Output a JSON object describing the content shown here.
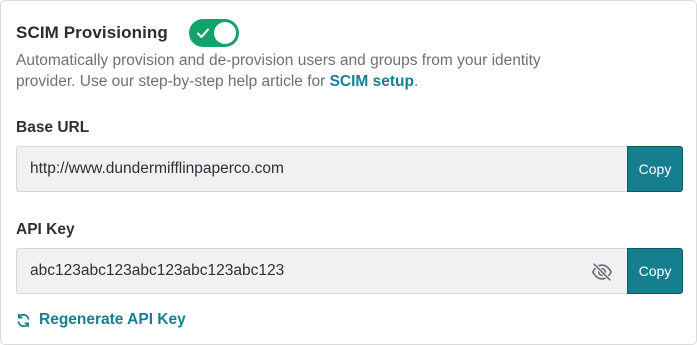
{
  "scim": {
    "title": "SCIM Provisioning",
    "enabled": true,
    "description_text": "Automatically provision and de-provision users and groups from your identity provider. Use our step-by-step help article for ",
    "description_link": "SCIM setup",
    "description_end": "."
  },
  "base_url": {
    "label": "Base URL",
    "value": "http://www.dundermifflinpaperco.com",
    "copy_label": "Copy"
  },
  "api_key": {
    "label": "API Key",
    "value": "abc123abc123abc123abc123abc123",
    "copy_label": "Copy",
    "visibility_icon": "eye-off-icon"
  },
  "regenerate": {
    "label": "Regenerate API Key",
    "icon": "refresh-icon"
  },
  "colors": {
    "accent": "#16808f",
    "toggle_on": "#11a36a",
    "field_bg": "#f1f1f2"
  }
}
